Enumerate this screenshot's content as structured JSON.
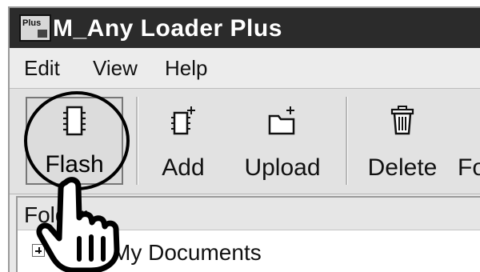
{
  "window": {
    "title": "M_Any Loader Plus",
    "app_icon_label": "Plus"
  },
  "menu": {
    "items": [
      "Edit",
      "View",
      "Help"
    ]
  },
  "toolbar": {
    "buttons": [
      {
        "label": "Flash",
        "icon": "flash-icon",
        "selected": true
      },
      {
        "label": "Add",
        "icon": "add-icon"
      },
      {
        "label": "Upload",
        "icon": "upload-icon"
      },
      {
        "label": "Delete",
        "icon": "delete-icon"
      },
      {
        "label": "Fo",
        "icon": "format-icon"
      }
    ]
  },
  "folder_pane": {
    "header": "Folder",
    "items": [
      {
        "label": "My Documents",
        "icon": "folder-icon",
        "expandable": true
      }
    ]
  },
  "colors": {
    "titlebar": "#2b2b2b",
    "menu_bg": "#ececec",
    "toolbar_bg": "#e2e2e2"
  }
}
